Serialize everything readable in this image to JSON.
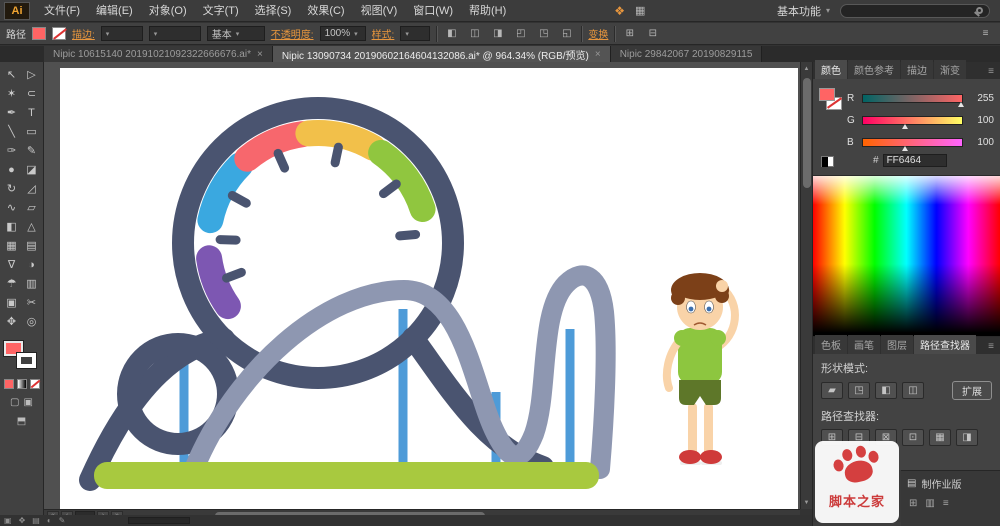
{
  "app": {
    "logo": "Ai"
  },
  "menubar": {
    "items": [
      "文件(F)",
      "编辑(E)",
      "对象(O)",
      "文字(T)",
      "选择(S)",
      "效果(C)",
      "视图(V)",
      "窗口(W)",
      "帮助(H)"
    ],
    "workspace": "基本功能"
  },
  "controlbar": {
    "context": "路径",
    "stroke_label": "描边:",
    "style_value": "基本",
    "opacity_label": "不透明度:",
    "opacity_value": "100%",
    "graphic_style_label": "样式:",
    "transform_label": "变换"
  },
  "tabs": [
    {
      "title": "Nipic 10615140 20191021092322666676.ai*",
      "close": "×"
    },
    {
      "title": "Nipic 13090734 20190602164604132086.ai* @ 964.34% (RGB/预览)",
      "close": "×"
    },
    {
      "title": "Nipic 29842067 20190829115",
      "close": ""
    }
  ],
  "toolbar": {
    "tools": [
      {
        "name": "selection-tool",
        "glyph": "↖"
      },
      {
        "name": "direct-selection-tool",
        "glyph": "▷"
      },
      {
        "name": "magic-wand-tool",
        "glyph": "✶"
      },
      {
        "name": "lasso-tool",
        "glyph": "⊂"
      },
      {
        "name": "pen-tool",
        "glyph": "✒"
      },
      {
        "name": "type-tool",
        "glyph": "T"
      },
      {
        "name": "line-segment-tool",
        "glyph": "╲"
      },
      {
        "name": "rectangle-tool",
        "glyph": "▭"
      },
      {
        "name": "paintbrush-tool",
        "glyph": "✑"
      },
      {
        "name": "pencil-tool",
        "glyph": "✎"
      },
      {
        "name": "blob-brush-tool",
        "glyph": "●"
      },
      {
        "name": "eraser-tool",
        "glyph": "◪"
      },
      {
        "name": "rotate-tool",
        "glyph": "↻"
      },
      {
        "name": "scale-tool",
        "glyph": "◿"
      },
      {
        "name": "width-tool",
        "glyph": "∿"
      },
      {
        "name": "free-transform-tool",
        "glyph": "▱"
      },
      {
        "name": "shape-builder-tool",
        "glyph": "◧"
      },
      {
        "name": "perspective-grid-tool",
        "glyph": "△"
      },
      {
        "name": "mesh-tool",
        "glyph": "▦"
      },
      {
        "name": "gradient-tool",
        "glyph": "▤"
      },
      {
        "name": "eyedropper-tool",
        "glyph": "∇"
      },
      {
        "name": "blend-tool",
        "glyph": "◑"
      },
      {
        "name": "symbol-sprayer-tool",
        "glyph": "☂"
      },
      {
        "name": "column-graph-tool",
        "glyph": "▥"
      },
      {
        "name": "artboard-tool",
        "glyph": "▣"
      },
      {
        "name": "slice-tool",
        "glyph": "✂"
      },
      {
        "name": "hand-tool",
        "glyph": "✥"
      },
      {
        "name": "zoom-tool",
        "glyph": "◎"
      }
    ]
  },
  "rightpanel": {
    "dock1_tabs": [
      "颜色",
      "颜色参考",
      "描边",
      "渐变"
    ],
    "color": {
      "channels": [
        {
          "label": "R",
          "value": "255"
        },
        {
          "label": "G",
          "value": "100"
        },
        {
          "label": "B",
          "value": "100"
        }
      ],
      "hex_prefix": "#",
      "hex_value": "FF6464"
    },
    "dock2_tabs": [
      "色板",
      "画笔",
      "图层",
      "路径查找器"
    ],
    "pathfinder": {
      "shape_modes_label": "形状模式:",
      "expand_button": "扩展",
      "pathfinder_label": "路径查找器:",
      "shape_mode_buttons": [
        {
          "name": "unite",
          "glyph": "▰"
        },
        {
          "name": "minus-front",
          "glyph": "◳"
        },
        {
          "name": "intersect",
          "glyph": "◧"
        },
        {
          "name": "exclude",
          "glyph": "◫"
        }
      ],
      "pathfinder_buttons": [
        {
          "name": "divide",
          "glyph": "⊞"
        },
        {
          "name": "trim",
          "glyph": "⊟"
        },
        {
          "name": "merge",
          "glyph": "⊠"
        },
        {
          "name": "crop",
          "glyph": "⊡"
        },
        {
          "name": "outline",
          "glyph": "▦"
        },
        {
          "name": "minus-back",
          "glyph": "◨"
        }
      ]
    },
    "bottom_panel_title": "制作业版"
  },
  "statusbar": {
    "icons": [
      "▣",
      "✥",
      "▤",
      "◐",
      "✎"
    ]
  },
  "watermark": {
    "text": "脚本之家"
  },
  "icons": {
    "caret": "▾",
    "panel_menu": "≡",
    "up": "▲",
    "down": "▼",
    "first": "«",
    "prev": "‹",
    "next": "›",
    "last": "»",
    "app_icon": "❖",
    "arrange_documents": "▦"
  },
  "artwork": {
    "track_dark": "#4a5470",
    "track_light": "#8e97b1",
    "post_blue": "#4e9bd8",
    "grass": "#a8c93f",
    "gear_pink": "#f7676d",
    "gear_yellow": "#f2c04a",
    "gear_green": "#90c63f",
    "gear_blue": "#3aa8e0",
    "gear_purple": "#7d57b2",
    "skin": "#f9d3a8",
    "hair": "#7c4018",
    "shirt": "#8dc63f",
    "shorts": "#5e7729",
    "shoes": "#cf3a3a",
    "sole": "#eeeeee"
  }
}
